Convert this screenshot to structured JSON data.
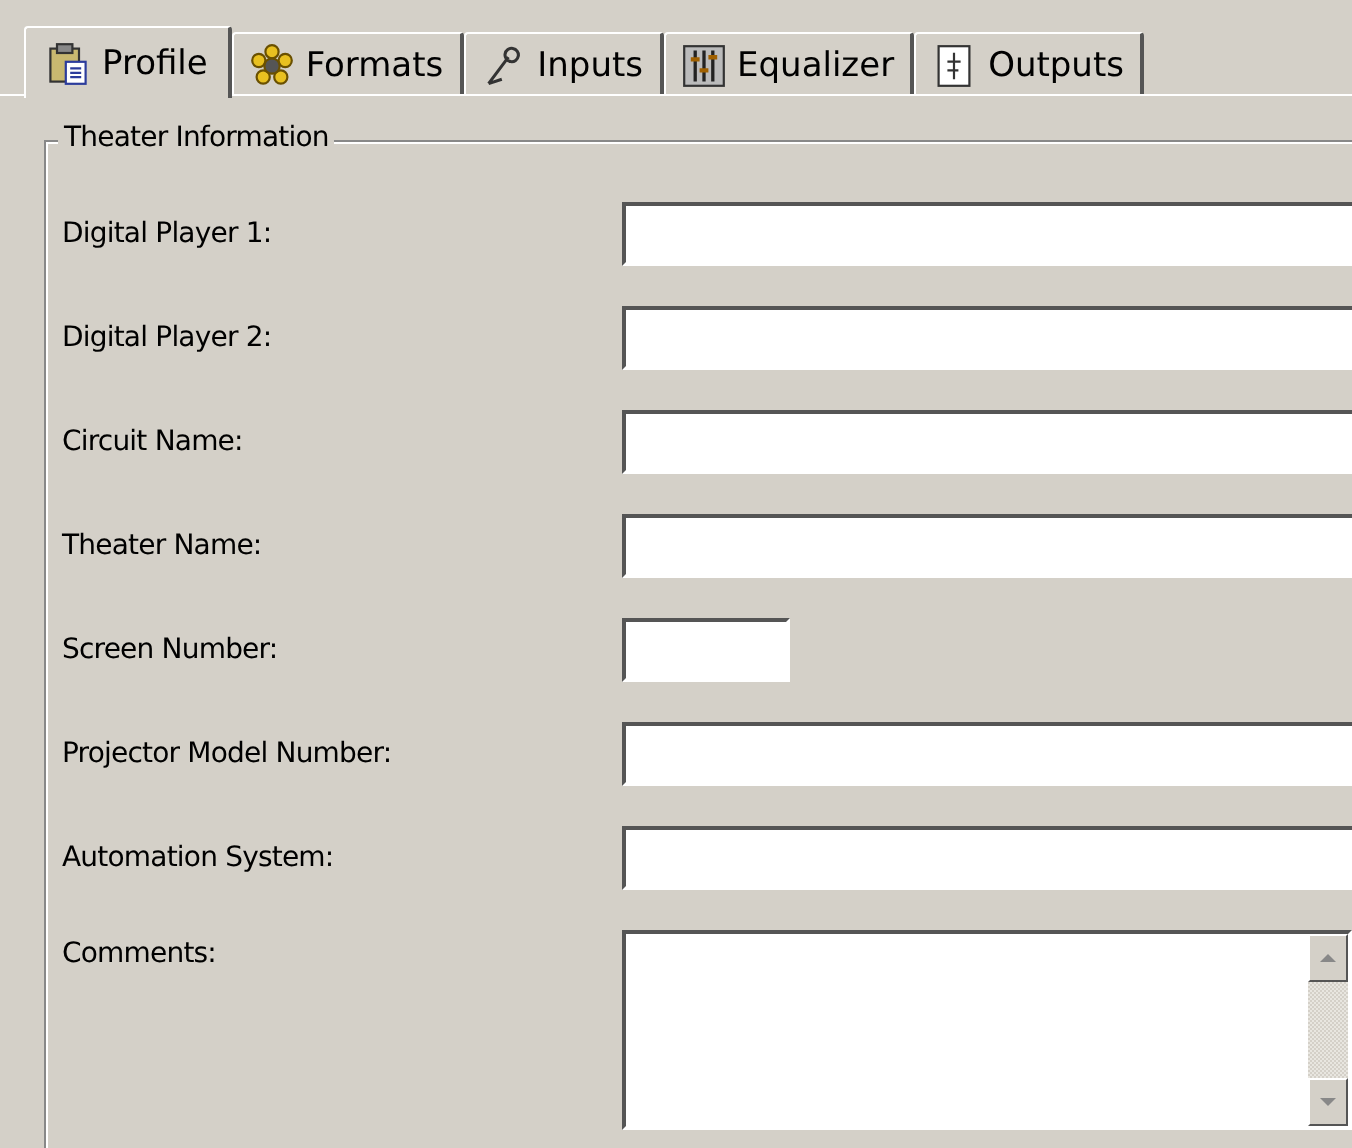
{
  "tabs": [
    {
      "label": "Profile",
      "kind": "clipboard",
      "selected": true
    },
    {
      "label": "Formats",
      "kind": "gear",
      "selected": false
    },
    {
      "label": "Inputs",
      "kind": "pen",
      "selected": false
    },
    {
      "label": "Equalizer",
      "kind": "sliders",
      "selected": false
    },
    {
      "label": "Outputs",
      "kind": "document",
      "selected": false
    }
  ],
  "group": {
    "title": "Theater Information",
    "fields": [
      {
        "label": "Digital Player 1:",
        "kind": "text"
      },
      {
        "label": "Digital Player 2:",
        "kind": "text"
      },
      {
        "label": "Circuit Name:",
        "kind": "text"
      },
      {
        "label": "Theater Name:",
        "kind": "text"
      },
      {
        "label": "Screen Number:",
        "kind": "short"
      },
      {
        "label": "Projector Model Number:",
        "kind": "text"
      },
      {
        "label": "Automation System:",
        "kind": "text"
      },
      {
        "label": "Comments:",
        "kind": "multiline"
      }
    ]
  }
}
